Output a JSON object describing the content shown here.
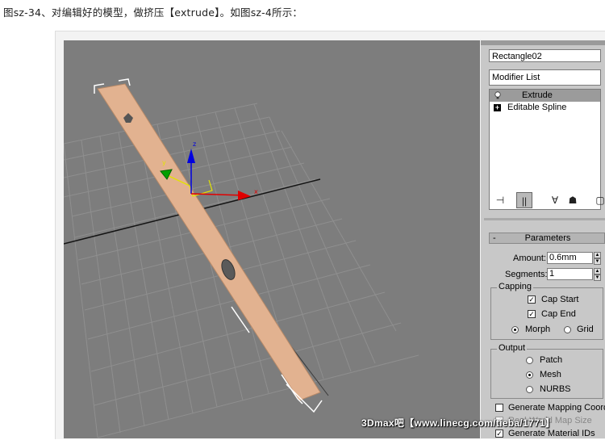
{
  "caption": "图sz-34、对编辑好的模型，做挤压【extrude】。如图sz-4所示：",
  "panel": {
    "object_name": "Rectangle02",
    "modifier_list_label": "Modifier List",
    "stack": [
      {
        "label": "Extrude",
        "selected": true
      },
      {
        "label": "Editable Spline",
        "selected": false
      }
    ],
    "parameters": {
      "title": "Parameters",
      "collapse": "-",
      "amount_label": "Amount:",
      "amount_value": "0.6mm",
      "segments_label": "Segments:",
      "segments_value": "1",
      "capping_title": "Capping",
      "cap_start_label": "Cap Start",
      "cap_start_checked": true,
      "cap_end_label": "Cap End",
      "cap_end_checked": true,
      "morph_label": "Morph",
      "grid_label": "Grid",
      "capping_selected": "Morph",
      "output_title": "Output",
      "patch_label": "Patch",
      "mesh_label": "Mesh",
      "nurbs_label": "NURBS",
      "output_selected": "Mesh",
      "gen_mapping_label": "Generate Mapping Coord",
      "real_world_label": "Real-World Map Size",
      "gen_material_label": "Generate Material IDs",
      "gen_material_checked": true
    }
  },
  "watermark": "3Dmax吧【www.linecg.com/tieba/1771】",
  "colors": {
    "viewport_bg": "#7d7d7d",
    "grid": "#8e8e8e",
    "object_fill": "#e2b290",
    "axis_x": "#e00000",
    "axis_y": "#00a000",
    "axis_z": "#0000e0"
  }
}
